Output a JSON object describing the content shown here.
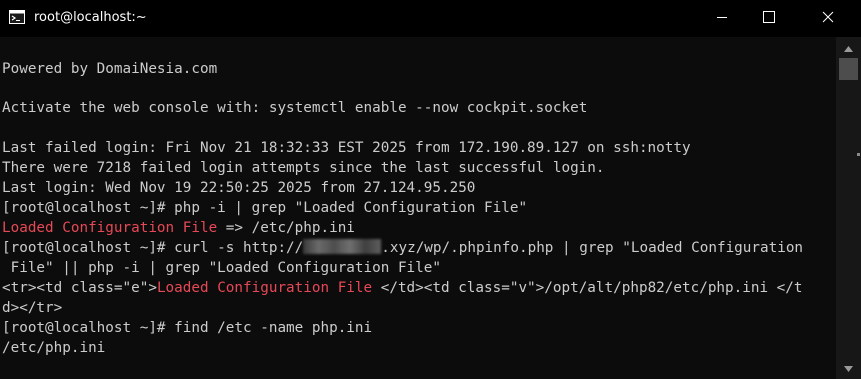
{
  "window": {
    "title": "root@localhost:~",
    "controls": {
      "minimize_icon": "minimize-icon",
      "maximize_icon": "maximize-icon",
      "close_icon": "close-icon"
    }
  },
  "console": {
    "lines": {
      "l0": "Powered by DomaiNesia.com",
      "l1": "Activate the web console with: systemctl enable --now cockpit.socket",
      "l2": "Last failed login: Fri Nov 21 18:32:33 EST 2025 from 172.190.89.127 on ssh:notty",
      "l3": "There were 7218 failed login attempts since the last successful login.",
      "l4": "Last login: Wed Nov 19 22:50:25 2025 from 27.124.95.250",
      "l5": "[root@localhost ~]# php -i | grep \"Loaded Configuration File\"",
      "l6_red": "Loaded Configuration File",
      "l6_rest": " => /etc/php.ini",
      "l7_a": "[root@localhost ~]# curl -s http://",
      "l7_b": ".xyz/wp/.phpinfo.php | grep \"Loaded Configuration",
      "l8": " File\" || php -i | grep \"Loaded Configuration File\"",
      "l9_a": "<tr><td class=\"e\">",
      "l9_red": "Loaded Configuration File",
      "l9_b": " </td><td class=\"v\">/opt/alt/php82/etc/php.ini </t",
      "l10": "d></tr>",
      "l11": "[root@localhost ~]# find /etc -name php.ini",
      "l12": "/etc/php.ini"
    }
  },
  "colors": {
    "background": "#0c0c0c",
    "text": "#cccccc",
    "highlight": "#e74856",
    "titlebar": "#000000"
  }
}
